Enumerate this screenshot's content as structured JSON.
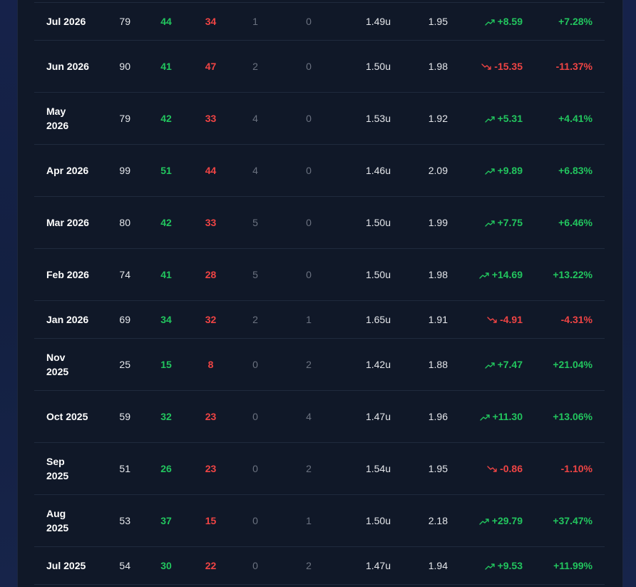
{
  "rows": [
    {
      "month": "Jul 2026",
      "total": "79",
      "wins": "44",
      "losses": "34",
      "pushes": "1",
      "pending": "0",
      "avg_stake": "1.49u",
      "avg_odds": "1.95",
      "profit": "+8.59",
      "roi": "+7.28%",
      "trend": "up"
    },
    {
      "month": "Jun 2026",
      "total": "90",
      "wins": "41",
      "losses": "47",
      "pushes": "2",
      "pending": "0",
      "avg_stake": "1.50u",
      "avg_odds": "1.98",
      "profit": "-15.35",
      "roi": "-11.37%",
      "trend": "down"
    },
    {
      "month": "May 2026",
      "total": "79",
      "wins": "42",
      "losses": "33",
      "pushes": "4",
      "pending": "0",
      "avg_stake": "1.53u",
      "avg_odds": "1.92",
      "profit": "+5.31",
      "roi": "+4.41%",
      "trend": "up"
    },
    {
      "month": "Apr 2026",
      "total": "99",
      "wins": "51",
      "losses": "44",
      "pushes": "4",
      "pending": "0",
      "avg_stake": "1.46u",
      "avg_odds": "2.09",
      "profit": "+9.89",
      "roi": "+6.83%",
      "trend": "up"
    },
    {
      "month": "Mar 2026",
      "total": "80",
      "wins": "42",
      "losses": "33",
      "pushes": "5",
      "pending": "0",
      "avg_stake": "1.50u",
      "avg_odds": "1.99",
      "profit": "+7.75",
      "roi": "+6.46%",
      "trend": "up"
    },
    {
      "month": "Feb 2026",
      "total": "74",
      "wins": "41",
      "losses": "28",
      "pushes": "5",
      "pending": "0",
      "avg_stake": "1.50u",
      "avg_odds": "1.98",
      "profit": "+14.69",
      "roi": "+13.22%",
      "trend": "up"
    },
    {
      "month": "Jan 2026",
      "total": "69",
      "wins": "34",
      "losses": "32",
      "pushes": "2",
      "pending": "1",
      "avg_stake": "1.65u",
      "avg_odds": "1.91",
      "profit": "-4.91",
      "roi": "-4.31%",
      "trend": "down"
    },
    {
      "month": "Nov 2025",
      "total": "25",
      "wins": "15",
      "losses": "8",
      "pushes": "0",
      "pending": "2",
      "avg_stake": "1.42u",
      "avg_odds": "1.88",
      "profit": "+7.47",
      "roi": "+21.04%",
      "trend": "up"
    },
    {
      "month": "Oct 2025",
      "total": "59",
      "wins": "32",
      "losses": "23",
      "pushes": "0",
      "pending": "4",
      "avg_stake": "1.47u",
      "avg_odds": "1.96",
      "profit": "+11.30",
      "roi": "+13.06%",
      "trend": "up"
    },
    {
      "month": "Sep 2025",
      "total": "51",
      "wins": "26",
      "losses": "23",
      "pushes": "0",
      "pending": "2",
      "avg_stake": "1.54u",
      "avg_odds": "1.95",
      "profit": "-0.86",
      "roi": "-1.10%",
      "trend": "down"
    },
    {
      "month": "Aug 2025",
      "total": "53",
      "wins": "37",
      "losses": "15",
      "pushes": "0",
      "pending": "1",
      "avg_stake": "1.50u",
      "avg_odds": "2.18",
      "profit": "+29.79",
      "roi": "+37.47%",
      "trend": "up"
    },
    {
      "month": "Jul 2025",
      "total": "54",
      "wins": "30",
      "losses": "22",
      "pushes": "0",
      "pending": "2",
      "avg_stake": "1.47u",
      "avg_odds": "1.94",
      "profit": "+9.53",
      "roi": "+11.99%",
      "trend": "up"
    }
  ],
  "colors": {
    "positive": "#22c55e",
    "negative": "#ef4444",
    "muted": "#6b7280",
    "panel": "#101828"
  },
  "icons": {
    "up": "trending-up-icon",
    "down": "trending-down-icon"
  }
}
